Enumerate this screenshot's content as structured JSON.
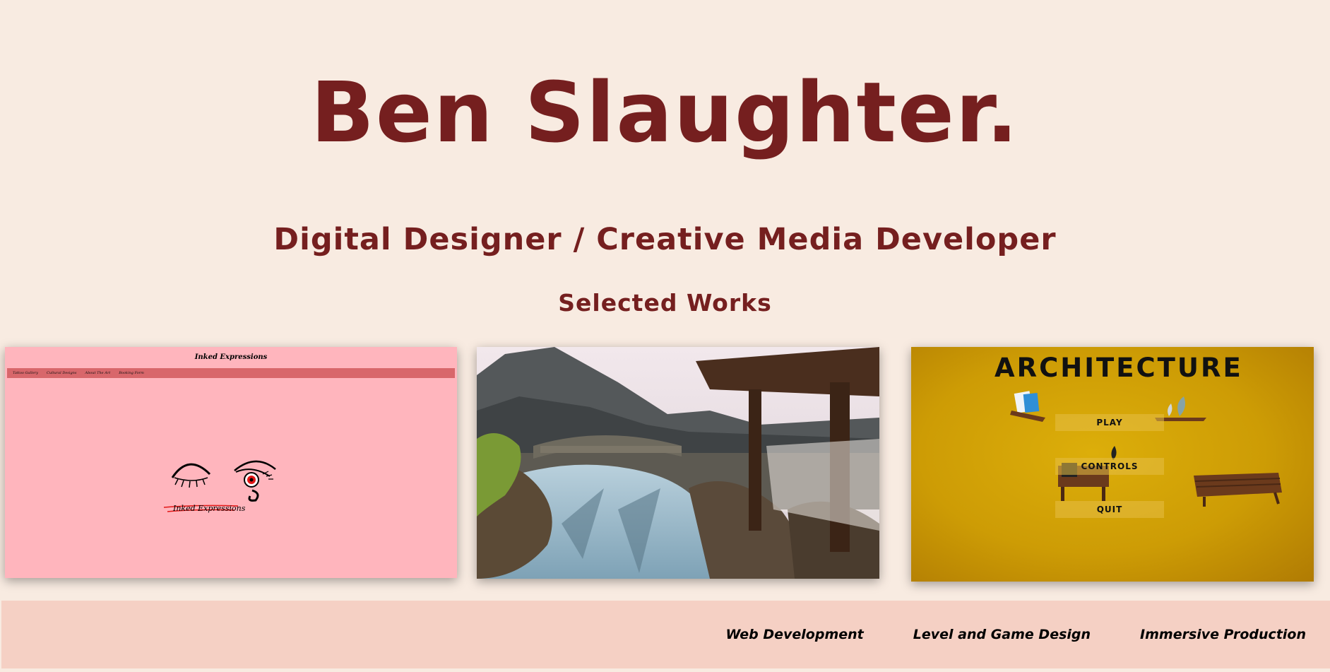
{
  "header": {
    "name": "Ben Slaughter.",
    "role": "Digital Designer / Creative Media Developer"
  },
  "works": {
    "section_title": "Selected Works",
    "cards": [
      {
        "kind": "web",
        "site_title": "Inked Expressions",
        "nav": [
          "Tattoo Gallery",
          "Cultural Designs",
          "About The Art",
          "Booking Form"
        ],
        "logo_text": "Inked Expressions"
      },
      {
        "kind": "level",
        "scene": "japanese-garden-bridge"
      },
      {
        "kind": "game",
        "title": "ARCHITECTURE",
        "buttons": [
          "PLAY",
          "CONTROLS",
          "QUIT"
        ]
      }
    ]
  },
  "footer": {
    "links": [
      "Web Development",
      "Level and Game Design",
      "Immersive Production"
    ]
  },
  "colors": {
    "background": "#f8ebe1",
    "accent": "#751f1f",
    "footer_bg": "#f5d0c4"
  }
}
